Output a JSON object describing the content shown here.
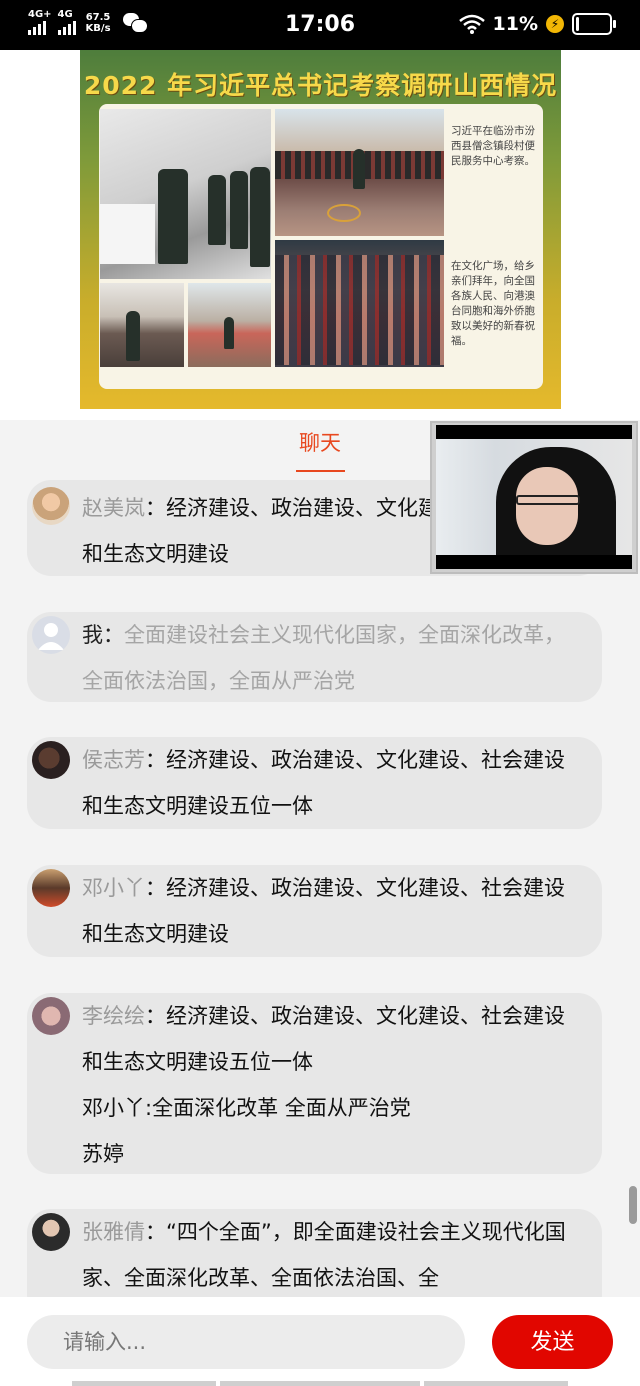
{
  "status_bar": {
    "signal1_label": "4G+",
    "signal2_label": "4G",
    "net_speed_value": "67.5",
    "net_speed_unit": "KB/s",
    "time": "17:06",
    "battery_percent": "11%",
    "battery_level": 0.11,
    "icons": [
      "signal-icon",
      "signal-icon",
      "wechat-icon",
      "wifi-icon",
      "charging-icon",
      "battery-icon"
    ]
  },
  "slide": {
    "title": "2022 年习近平总书记考察调研山西情况",
    "caption1": "习近平在临汾市汾西县僧念镇段村便民服务中心考察。",
    "caption2": "在文化广场，给乡亲们拜年，向全国各族人民、向港澳台同胞和海外侨胞致以美好的新春祝福。"
  },
  "chat": {
    "tab_label": "聊天",
    "accent_color": "#e8481f",
    "messages": [
      {
        "user": "赵美岚",
        "sep": "：",
        "text": "经济建设、政治建设、文化建设、社会建设和生态文明建设"
      },
      {
        "user": "我",
        "sep": "：",
        "text": "全面建设社会主义现代化国家，全面深化改革，全面依法治国，全面从严治党"
      },
      {
        "user": "侯志芳",
        "sep": "：",
        "text": "经济建设、政治建设、文化建设、社会建设和生态文明建设五位一体"
      },
      {
        "user": "邓小丫",
        "sep": "：",
        "text": "经济建设、政治建设、文化建设、社会建设和生态文明建设"
      },
      {
        "user": "李绘绘",
        "sep": "：",
        "text": "经济建设、政治建设、文化建设、社会建设和生态文明建设五位一体",
        "extra1": "邓小丫:全面深化改革 全面从严治党",
        "extra2": "苏婷"
      },
      {
        "user": "张雅倩",
        "sep": "：",
        "text": "“四个全面”，即全面建设社会主义现代化国家、全面深化改革、全面依法治国、全"
      }
    ]
  },
  "input": {
    "placeholder": "请输入...",
    "send_label": "发送",
    "send_color": "#e10600"
  }
}
